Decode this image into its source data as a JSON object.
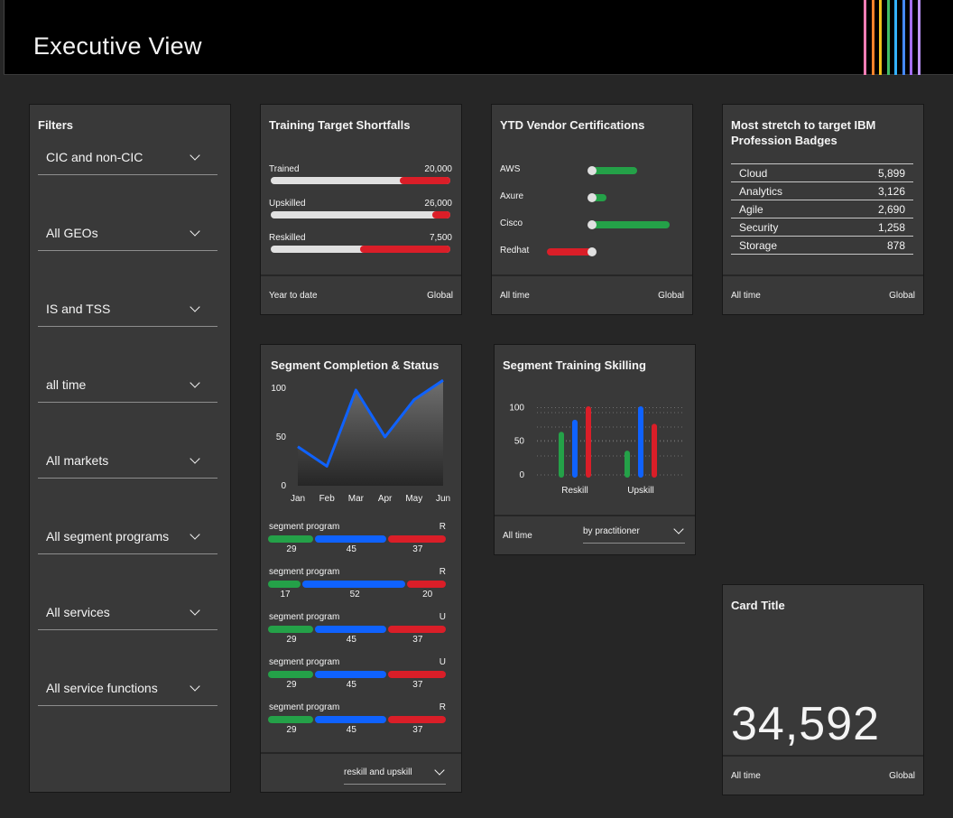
{
  "header": {
    "title": "Executive View",
    "stripe_colors": [
      "#ff7eb6",
      "#ff832b",
      "#f1c21b",
      "#42be65",
      "#33b1ff",
      "#4589ff",
      "#a56eff",
      "#be95ff"
    ]
  },
  "colors": {
    "green": "#24a148",
    "blue": "#0f62fe",
    "red": "#da1e28",
    "track": "#e0e0e0"
  },
  "filters": {
    "title": "Filters",
    "items": [
      "CIC and non-CIC",
      "All GEOs",
      "IS and TSS",
      "all time",
      "All markets",
      "All segment programs",
      "All services",
      "All service functions"
    ]
  },
  "shortfalls": {
    "title": "Training Target Shortfalls",
    "rows": [
      {
        "label": "Trained",
        "value": "20,000",
        "red_fraction": 0.28
      },
      {
        "label": "Upskilled",
        "value": "26,000",
        "red_fraction": 0.1
      },
      {
        "label": "Reskilled",
        "value": "7,500",
        "red_fraction": 0.5
      }
    ],
    "footer_left": "Year to date",
    "footer_right": "Global"
  },
  "vendor": {
    "title": "YTD Vendor Certifications",
    "rows": [
      {
        "label": "AWS",
        "color": "green",
        "direction": "right",
        "fraction": 0.55
      },
      {
        "label": "Axure",
        "color": "green",
        "direction": "right",
        "fraction": 0.18
      },
      {
        "label": "Cisco",
        "color": "green",
        "direction": "right",
        "fraction": 0.95
      },
      {
        "label": "Redhat",
        "color": "red",
        "direction": "left",
        "fraction": 0.55
      }
    ],
    "footer_left": "All time",
    "footer_right": "Global"
  },
  "badges": {
    "title_line1": "Most stretch to target IBM",
    "title_line2": "Profession Badges",
    "rows": [
      {
        "name": "Cloud",
        "value": "5,899"
      },
      {
        "name": "Analytics",
        "value": "3,126"
      },
      {
        "name": "Agile",
        "value": "2,690"
      },
      {
        "name": "Security",
        "value": "1,258"
      },
      {
        "name": "Storage",
        "value": "878"
      }
    ],
    "footer_left": "All time",
    "footer_right": "Global"
  },
  "completion": {
    "title": "Segment Completion & Status",
    "programs": [
      {
        "label": "segment program",
        "status": "R",
        "values": [
          29,
          45,
          37
        ]
      },
      {
        "label": "segment program",
        "status": "R",
        "values": [
          17,
          52,
          20
        ]
      },
      {
        "label": "segment program",
        "status": "U",
        "values": [
          29,
          45,
          37
        ]
      },
      {
        "label": "segment program",
        "status": "U",
        "values": [
          29,
          45,
          37
        ]
      },
      {
        "label": "segment program",
        "status": "R",
        "values": [
          29,
          45,
          37
        ]
      }
    ],
    "dropdown": "reskill and upskill"
  },
  "skilling": {
    "title": "Segment Training Skilling",
    "footer_left": "All time",
    "dropdown": "by practitioner"
  },
  "kpi": {
    "title": "Card Title",
    "value": "34,592",
    "footer_left": "All time",
    "footer_right": "Global"
  },
  "chart_data": [
    {
      "type": "area",
      "x": [
        "Jan",
        "Feb",
        "Mar",
        "Apr",
        "May",
        "Jun"
      ],
      "values": [
        40,
        20,
        98,
        50,
        88,
        108
      ],
      "yticks": [
        0,
        50,
        100
      ],
      "ylim": [
        0,
        110
      ]
    },
    {
      "type": "bar",
      "categories": [
        "Reskill",
        "Upskill"
      ],
      "series": [
        {
          "color": "green",
          "values": [
            60,
            32
          ]
        },
        {
          "color": "blue",
          "values": [
            78,
            98
          ]
        },
        {
          "color": "red",
          "values": [
            98,
            72
          ]
        }
      ],
      "yticks": [
        0,
        50,
        100
      ],
      "ylim": [
        0,
        110
      ]
    }
  ]
}
